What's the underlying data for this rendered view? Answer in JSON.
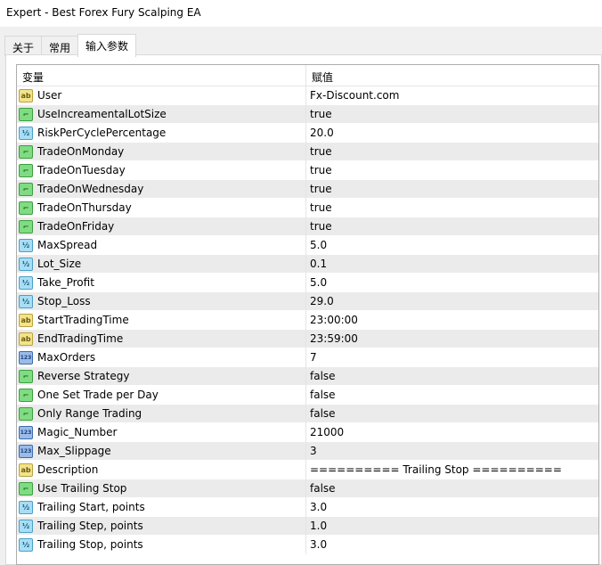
{
  "window": {
    "title": "Expert - Best Forex Fury Scalping EA"
  },
  "tabs": [
    {
      "label": "关于"
    },
    {
      "label": "常用"
    },
    {
      "label": "输入参数"
    }
  ],
  "table": {
    "headers": {
      "variable": "变量",
      "value": "赋值"
    },
    "rows": [
      {
        "type": "ab",
        "icon": "string-icon",
        "name": "User",
        "value": "Fx-Discount.com"
      },
      {
        "type": "bool",
        "icon": "bool-icon",
        "name": "UseIncreamentalLotSize",
        "value": "true"
      },
      {
        "type": "dbl",
        "icon": "double-icon",
        "name": "RiskPerCyclePercentage",
        "value": "20.0"
      },
      {
        "type": "bool",
        "icon": "bool-icon",
        "name": "TradeOnMonday",
        "value": "true"
      },
      {
        "type": "bool",
        "icon": "bool-icon",
        "name": "TradeOnTuesday",
        "value": "true"
      },
      {
        "type": "bool",
        "icon": "bool-icon",
        "name": "TradeOnWednesday",
        "value": "true"
      },
      {
        "type": "bool",
        "icon": "bool-icon",
        "name": "TradeOnThursday",
        "value": "true"
      },
      {
        "type": "bool",
        "icon": "bool-icon",
        "name": "TradeOnFriday",
        "value": "true"
      },
      {
        "type": "dbl",
        "icon": "double-icon",
        "name": "MaxSpread",
        "value": "5.0"
      },
      {
        "type": "dbl",
        "icon": "double-icon",
        "name": "Lot_Size",
        "value": "0.1"
      },
      {
        "type": "dbl",
        "icon": "double-icon",
        "name": "Take_Profit",
        "value": "5.0"
      },
      {
        "type": "dbl",
        "icon": "double-icon",
        "name": "Stop_Loss",
        "value": "29.0"
      },
      {
        "type": "ab",
        "icon": "string-icon",
        "name": "StartTradingTime",
        "value": "23:00:00"
      },
      {
        "type": "ab",
        "icon": "string-icon",
        "name": "EndTradingTime",
        "value": "23:59:00"
      },
      {
        "type": "int",
        "icon": "integer-icon",
        "name": "MaxOrders",
        "value": "7"
      },
      {
        "type": "bool",
        "icon": "bool-icon",
        "name": "Reverse Strategy",
        "value": "false"
      },
      {
        "type": "bool",
        "icon": "bool-icon",
        "name": "One Set Trade per Day",
        "value": "false"
      },
      {
        "type": "bool",
        "icon": "bool-icon",
        "name": "Only Range Trading",
        "value": "false"
      },
      {
        "type": "int",
        "icon": "integer-icon",
        "name": "Magic_Number",
        "value": "21000"
      },
      {
        "type": "int",
        "icon": "integer-icon",
        "name": "Max_Slippage",
        "value": "3"
      },
      {
        "type": "ab",
        "icon": "string-icon",
        "name": "Description",
        "value": "========== Trailing Stop =========="
      },
      {
        "type": "bool",
        "icon": "bool-icon",
        "name": "Use Trailing Stop",
        "value": "false"
      },
      {
        "type": "dbl",
        "icon": "double-icon",
        "name": "Trailing Start, points",
        "value": "3.0"
      },
      {
        "type": "dbl",
        "icon": "double-icon",
        "name": "Trailing Step, points",
        "value": "1.0"
      },
      {
        "type": "dbl",
        "icon": "double-icon",
        "name": "Trailing Stop, points",
        "value": "3.0"
      }
    ]
  }
}
